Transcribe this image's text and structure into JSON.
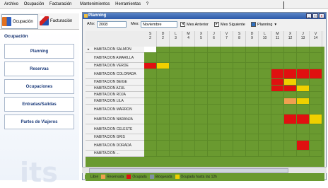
{
  "menu": [
    "Archivo",
    "Ocupación",
    "Facturación",
    "Mantenimientos",
    "Herramientas",
    "?"
  ],
  "outer_tabs": [
    {
      "label": "Ocupación",
      "icon": "rooms-icon"
    },
    {
      "label": "Facturación",
      "icon": "billing-icon"
    }
  ],
  "left_panel": {
    "title": "Ocupación",
    "buttons": [
      "Planning",
      "Reservas",
      "Ocupaciones",
      "Entradas/Salidas",
      "Partes de Viajeros"
    ]
  },
  "watermark": "its",
  "window": {
    "title": "Planning",
    "controls": [
      "_",
      "□",
      "x"
    ]
  },
  "toolbar": {
    "year_label": "Año:",
    "year_value": "2008",
    "month_label": "Mes:",
    "month_value": "Noviembre",
    "prev_label": "Mes Anterior",
    "next_label": "Mes Siguiente",
    "planning_label": "Planning"
  },
  "days": [
    {
      "dow": "S",
      "num": "2"
    },
    {
      "dow": "D",
      "num": "2"
    },
    {
      "dow": "L",
      "num": "3"
    },
    {
      "dow": "M",
      "num": "4"
    },
    {
      "dow": "X",
      "num": "5"
    },
    {
      "dow": "J",
      "num": "6"
    },
    {
      "dow": "V",
      "num": "7"
    },
    {
      "dow": "S",
      "num": "8"
    },
    {
      "dow": "D",
      "num": "9"
    },
    {
      "dow": "L",
      "num": "10"
    },
    {
      "dow": "M",
      "num": "11"
    },
    {
      "dow": "X",
      "num": "12"
    },
    {
      "dow": "J",
      "num": "13"
    },
    {
      "dow": "V",
      "num": "14"
    }
  ],
  "rooms": [
    "HABITACION SALMON",
    "HABITACION AMARILLA",
    "HABITACION VERDE",
    "HABITACION COLORADA",
    "HABITACION BEIGE",
    "HABITACION AZUL",
    "HABITACION ROJA",
    "HABITACION LILA",
    "HABITACION MARRON",
    "HABITACION NARANJA",
    "HABITACION CELESTE",
    "HABITACION GRIS",
    "HABITACION DORADA",
    "HABITACION ..."
  ],
  "legend": [
    {
      "label": "Libre",
      "color": "#6a9a30"
    },
    {
      "label": "Reservada",
      "color": "#f0a050"
    },
    {
      "label": "Ocupada",
      "color": "#e01010"
    },
    {
      "label": "Bloqueada",
      "color": "#8090a0"
    },
    {
      "label": "Ocupada hasta las 12h",
      "color": "#f0d000"
    }
  ],
  "colors": {
    "free": "#6a9a30",
    "reserved": "#f0a050",
    "occupied": "#e01010",
    "until12": "#f0d000",
    "blank": "#ffffff"
  },
  "occupancy": [
    [
      "blank"
    ],
    [],
    [
      "occupied",
      "until12"
    ],
    [
      null,
      null,
      null,
      null,
      null,
      null,
      null,
      null,
      null,
      null,
      "occupied",
      "occupied",
      "occupied",
      "occupied"
    ],
    [
      null,
      null,
      null,
      null,
      null,
      null,
      null,
      null,
      null,
      null,
      "occupied",
      "until12"
    ],
    [
      null,
      null,
      null,
      null,
      null,
      null,
      null,
      null,
      null,
      null,
      "occupied",
      "occupied",
      "until12"
    ],
    [],
    [
      null,
      null,
      null,
      null,
      null,
      null,
      null,
      null,
      null,
      null,
      null,
      "reserved",
      "until12"
    ],
    [],
    [
      null,
      null,
      null,
      null,
      null,
      null,
      null,
      null,
      null,
      null,
      null,
      "occupied",
      "occupied",
      "until12"
    ],
    [],
    [],
    [
      null,
      null,
      null,
      null,
      null,
      null,
      null,
      null,
      null,
      null,
      null,
      null,
      "occupied"
    ],
    []
  ]
}
